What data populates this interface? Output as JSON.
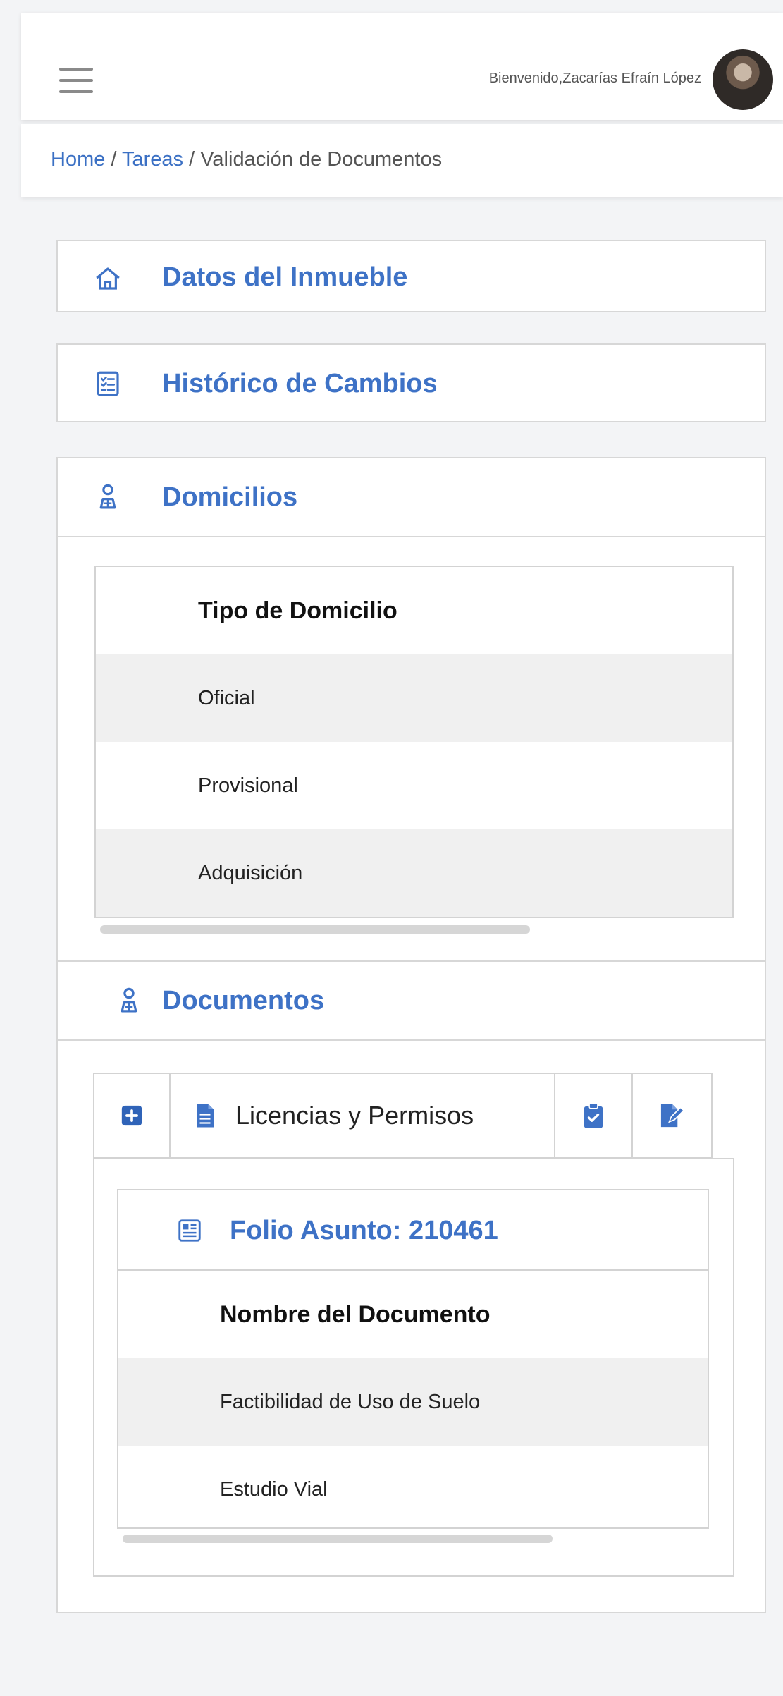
{
  "header": {
    "welcome_text": "Bienvenido,Zacarías Efraín López"
  },
  "breadcrumb": {
    "home": "Home",
    "separator1": " / ",
    "tareas": "Tareas",
    "separator2": " / ",
    "current": "Validación de Documentos"
  },
  "sections": {
    "datos": "Datos del Inmueble",
    "historico": "Histórico de Cambios",
    "domicilios": "Domicilios",
    "documentos": "Documentos"
  },
  "domicilios_table": {
    "header": "Tipo de Domicilio",
    "rows": [
      "Oficial",
      "Provisional",
      "Adquisición"
    ]
  },
  "documentos_tabs": {
    "active_label": "Licencias y Permisos"
  },
  "folio": {
    "title": "Folio Asunto: 210461",
    "table_header": "Nombre del Documento",
    "rows": [
      "Factibilidad de Uso de Suelo",
      "Estudio Vial"
    ]
  },
  "colors": {
    "accent": "#3e72c6"
  }
}
